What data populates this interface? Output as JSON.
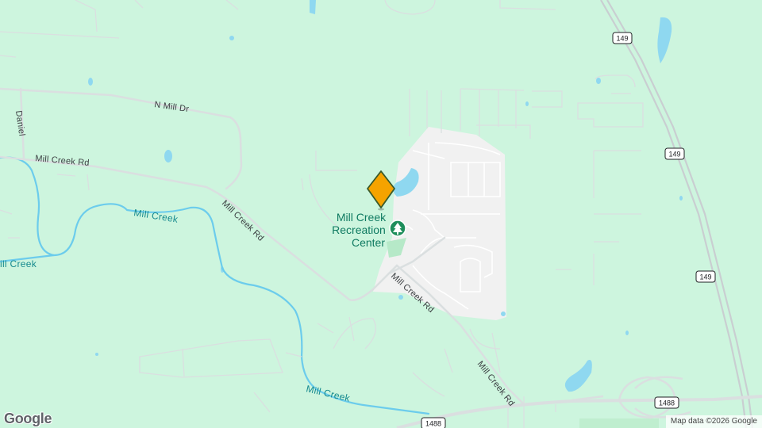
{
  "map": {
    "place_label_line1": "Mill Creek",
    "place_label_line2": "Recreation",
    "place_label_line3": "Center",
    "road_labels": {
      "n_mill_dr": "N Mill Dr",
      "daniel": "Daniel",
      "mill_creek_rd_west": "Mill Creek Rd",
      "mill_creek_rd_mid": "Mill Creek Rd",
      "mill_creek_rd_center": "Mill Creek Rd",
      "mill_creek_rd_south": "Mill Creek Rd"
    },
    "water_labels": {
      "mill_creek_north": "Mill Creek",
      "mill_creek_west": "ill Creek",
      "mill_creek_south": "Mill Creek"
    },
    "shields": {
      "s149_top": "149",
      "s149_mid": "149",
      "s149_low": "149",
      "s1488_left": "1488",
      "s1488_right": "1488"
    },
    "logo": "Google",
    "attribution": "Map data ©2026 Google",
    "colors": {
      "land": "#cdf5de",
      "developed": "#eef0ee",
      "water": "#8fd8f0",
      "creek": "#6cccec",
      "road": "#dadfe0",
      "marker": "#f5a300"
    }
  }
}
